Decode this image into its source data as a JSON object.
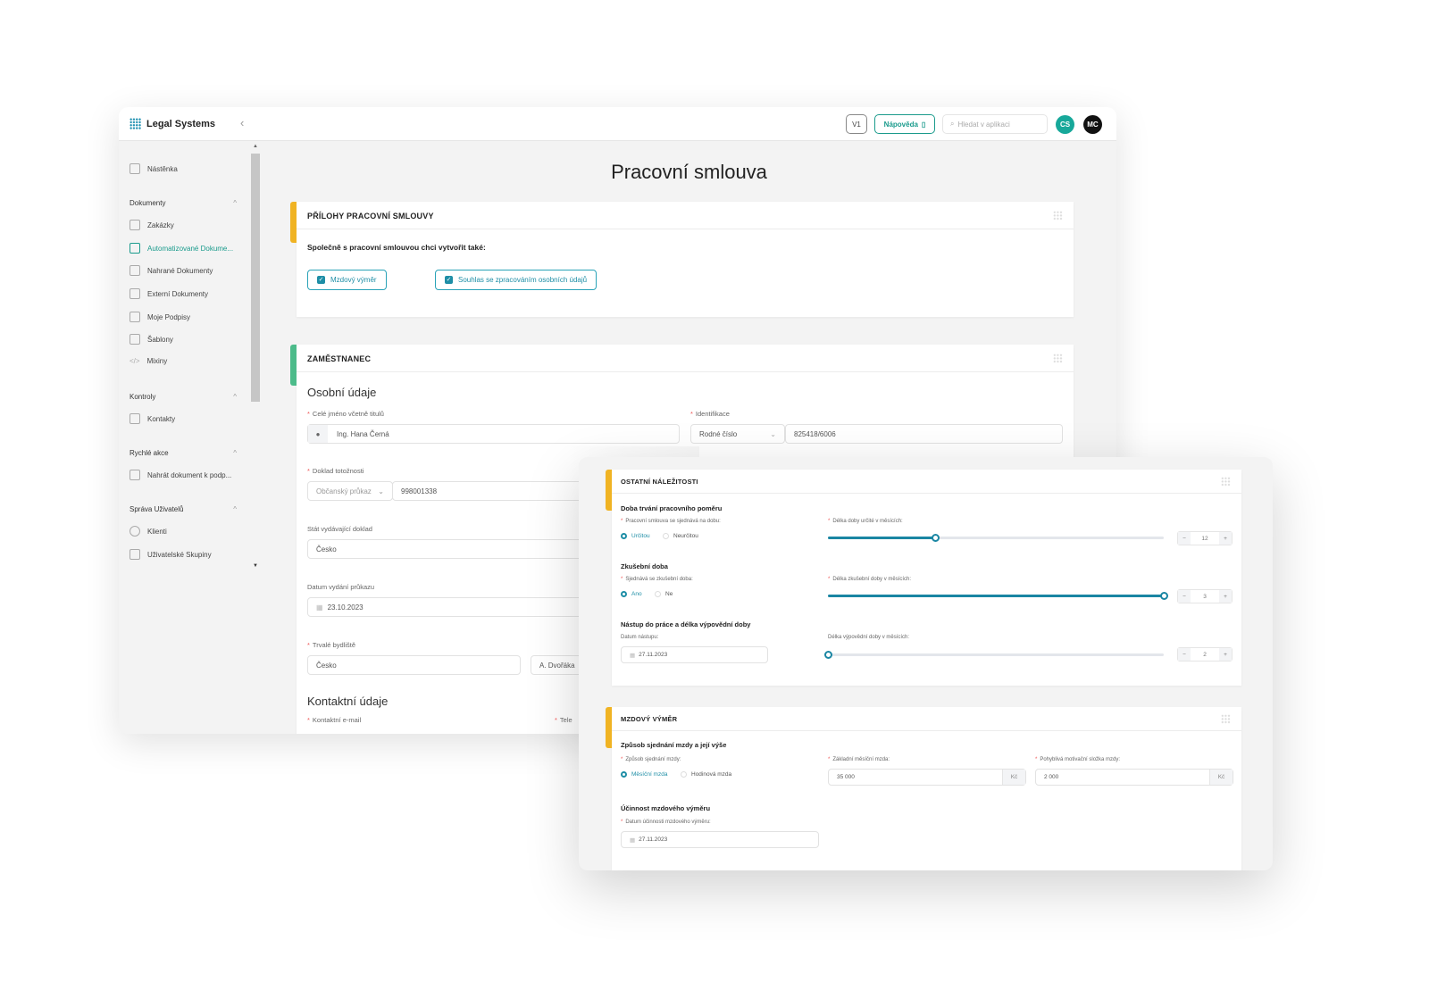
{
  "app": {
    "name": "Legal Systems",
    "version": "V1",
    "help": "Nápověda",
    "search_placeholder": "Hledat v aplikaci",
    "avatars": [
      {
        "initials": "CS",
        "color": "#17a89a"
      },
      {
        "initials": "MC",
        "color": "#111111"
      }
    ]
  },
  "sidebar": {
    "home": "Nástěnka",
    "groups": [
      {
        "label": "Dokumenty",
        "items": [
          "Zakázky",
          "Automatizované Dokume...",
          "Nahrané Dokumenty",
          "Externí Dokumenty",
          "Moje Podpisy",
          "Šablony",
          "Mixiny"
        ]
      },
      {
        "label": "Kontroly",
        "items": [
          "Kontakty"
        ]
      },
      {
        "label": "Rychlé akce",
        "items": [
          "Nahrát dokument k podp..."
        ]
      },
      {
        "label": "Správa Uživatelů",
        "items": [
          "Klienti",
          "Uživatelské Skupiny"
        ]
      }
    ],
    "active": "Automatizované Dokume..."
  },
  "page": {
    "title": "Pracovní smlouva"
  },
  "attachments": {
    "title": "PŘÍLOHY PRACOVNÍ SMLOUVY",
    "prompt": "Společně s pracovní smlouvou chci vytvořit také:",
    "options": [
      {
        "label": "Mzdový výměr",
        "checked": true
      },
      {
        "label": "Souhlas se zpracováním osobních údajů",
        "checked": true
      }
    ]
  },
  "employee": {
    "title": "ZAMĚSTNANEC",
    "personal": "Osobní údaje",
    "full_name_label": "Celé jméno včetně titulů",
    "full_name": "Ing. Hana Černá",
    "id_label": "Identifikace",
    "id_type": "Rodné číslo",
    "id_value": "825418/6006",
    "doc_label": "Doklad totožnosti",
    "doc_type": "Občanský průkaz",
    "doc_number": "998001338",
    "state_label": "Stát vydávající doklad",
    "state": "Česko",
    "issue_label": "Datum vydání průkazu",
    "issue_date": "23.10.2023",
    "residence_label": "Trvalé bydliště",
    "residence_country": "Česko",
    "residence_street": "A. Dvořáka",
    "contact": "Kontaktní údaje",
    "email_label": "Kontaktní e-mail",
    "phone_label": "Tele"
  },
  "other": {
    "title": "OSTATNÍ NÁLEŽITOSTI",
    "duration": {
      "heading": "Doba trvání pracovního poměru",
      "label": "Pracovní smlouva se sjednává na dobu:",
      "options": [
        "Určitou",
        "Neurčitou"
      ],
      "selected": 0,
      "slider_label": "Délka doby určité v měsících:",
      "value": "12",
      "fill_percent": 32
    },
    "probation": {
      "heading": "Zkušební doba",
      "label": "Sjednává se zkušební doba:",
      "options": [
        "Ano",
        "Ne"
      ],
      "selected": 0,
      "slider_label": "Délka zkušební doby v měsících:",
      "value": "3",
      "fill_percent": 100
    },
    "start": {
      "heading": "Nástup do práce a délka výpovědní doby",
      "date_label": "Datum nástupu:",
      "date": "27.11.2023",
      "slider_label": "Délka výpovědní doby v měsících:",
      "value": "2",
      "fill_percent": 0
    }
  },
  "wage": {
    "title": "MZDOVÝ VÝMĚR",
    "heading": "Způsob sjednání mzdy a její výše",
    "method_label": "Způsob sjednání mzdy:",
    "options": [
      "Měsíční mzda",
      "Hodinová mzda"
    ],
    "selected": 0,
    "base_label": "Základní měsíční mzda:",
    "base": "35 000",
    "variable_label": "Pohyblivá motivační složka mzdy:",
    "variable": "2 000",
    "currency": "Kč",
    "effect_heading": "Účinnost mzdového výměru",
    "effect_label": "Datum účinnosti mzdového výměru:",
    "effect_date": "27.11.2023"
  },
  "colors": {
    "accent": "#1e8ea6",
    "yellow": "#f0b323",
    "green": "#4cbb8a",
    "teal": "#17a89a"
  }
}
